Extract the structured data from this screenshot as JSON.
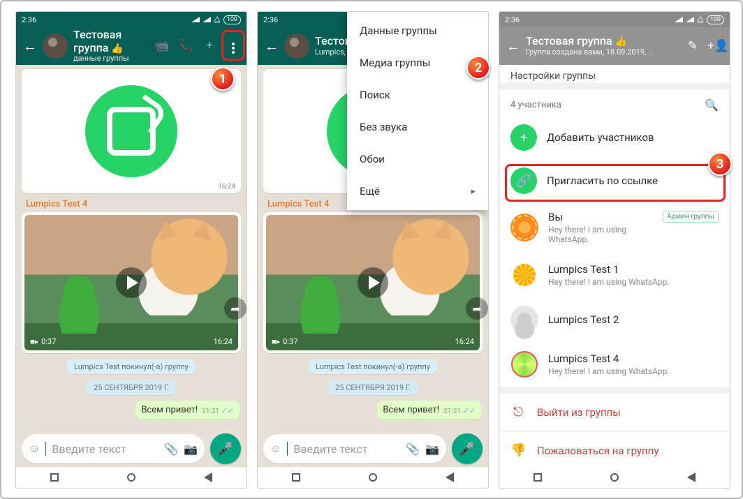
{
  "status": {
    "time": "2:36",
    "battery": "100"
  },
  "group": {
    "title": "Тестовая группа",
    "emoji": "👍",
    "subtitle_chat": "данные группы",
    "members_line": "Lumpics, Lumpics, Lumpics,...",
    "subtitle_info": "Группа создана вами, 18.09.2019,..."
  },
  "chat": {
    "img_time": "16:24",
    "sender": "Lumpics Test 4",
    "video_duration": "0:37",
    "video_time": "16:24",
    "system_left": "Lumpics Test покинул(-а) группу",
    "date_sep": "25 СЕНТЯБРЯ 2019 Г.",
    "out_msg": "Всем привет!",
    "out_time": "21:21",
    "input_placeholder": "Введите текст"
  },
  "menu": {
    "items": [
      "Данные группы",
      "Медиа группы",
      "Поиск",
      "Без звука",
      "Обои",
      "Ещё"
    ]
  },
  "info": {
    "settings_label": "Настройки группы",
    "participants_header": "4 участника",
    "add": "Добавить участников",
    "invite": "Пригласить по ссылке",
    "you": "Вы",
    "status_default": "Hey there! I am using WhatsApp.",
    "admin_badge": "Aдмин группы",
    "m1": "Lumpics Test 1",
    "m2": "Lumpics Test 2",
    "m4": "Lumpics Test 4",
    "exit": "Выйти из группы",
    "report": "Пожаловаться на группу"
  },
  "badges": {
    "n1": "1",
    "n2": "2",
    "n3": "3"
  }
}
